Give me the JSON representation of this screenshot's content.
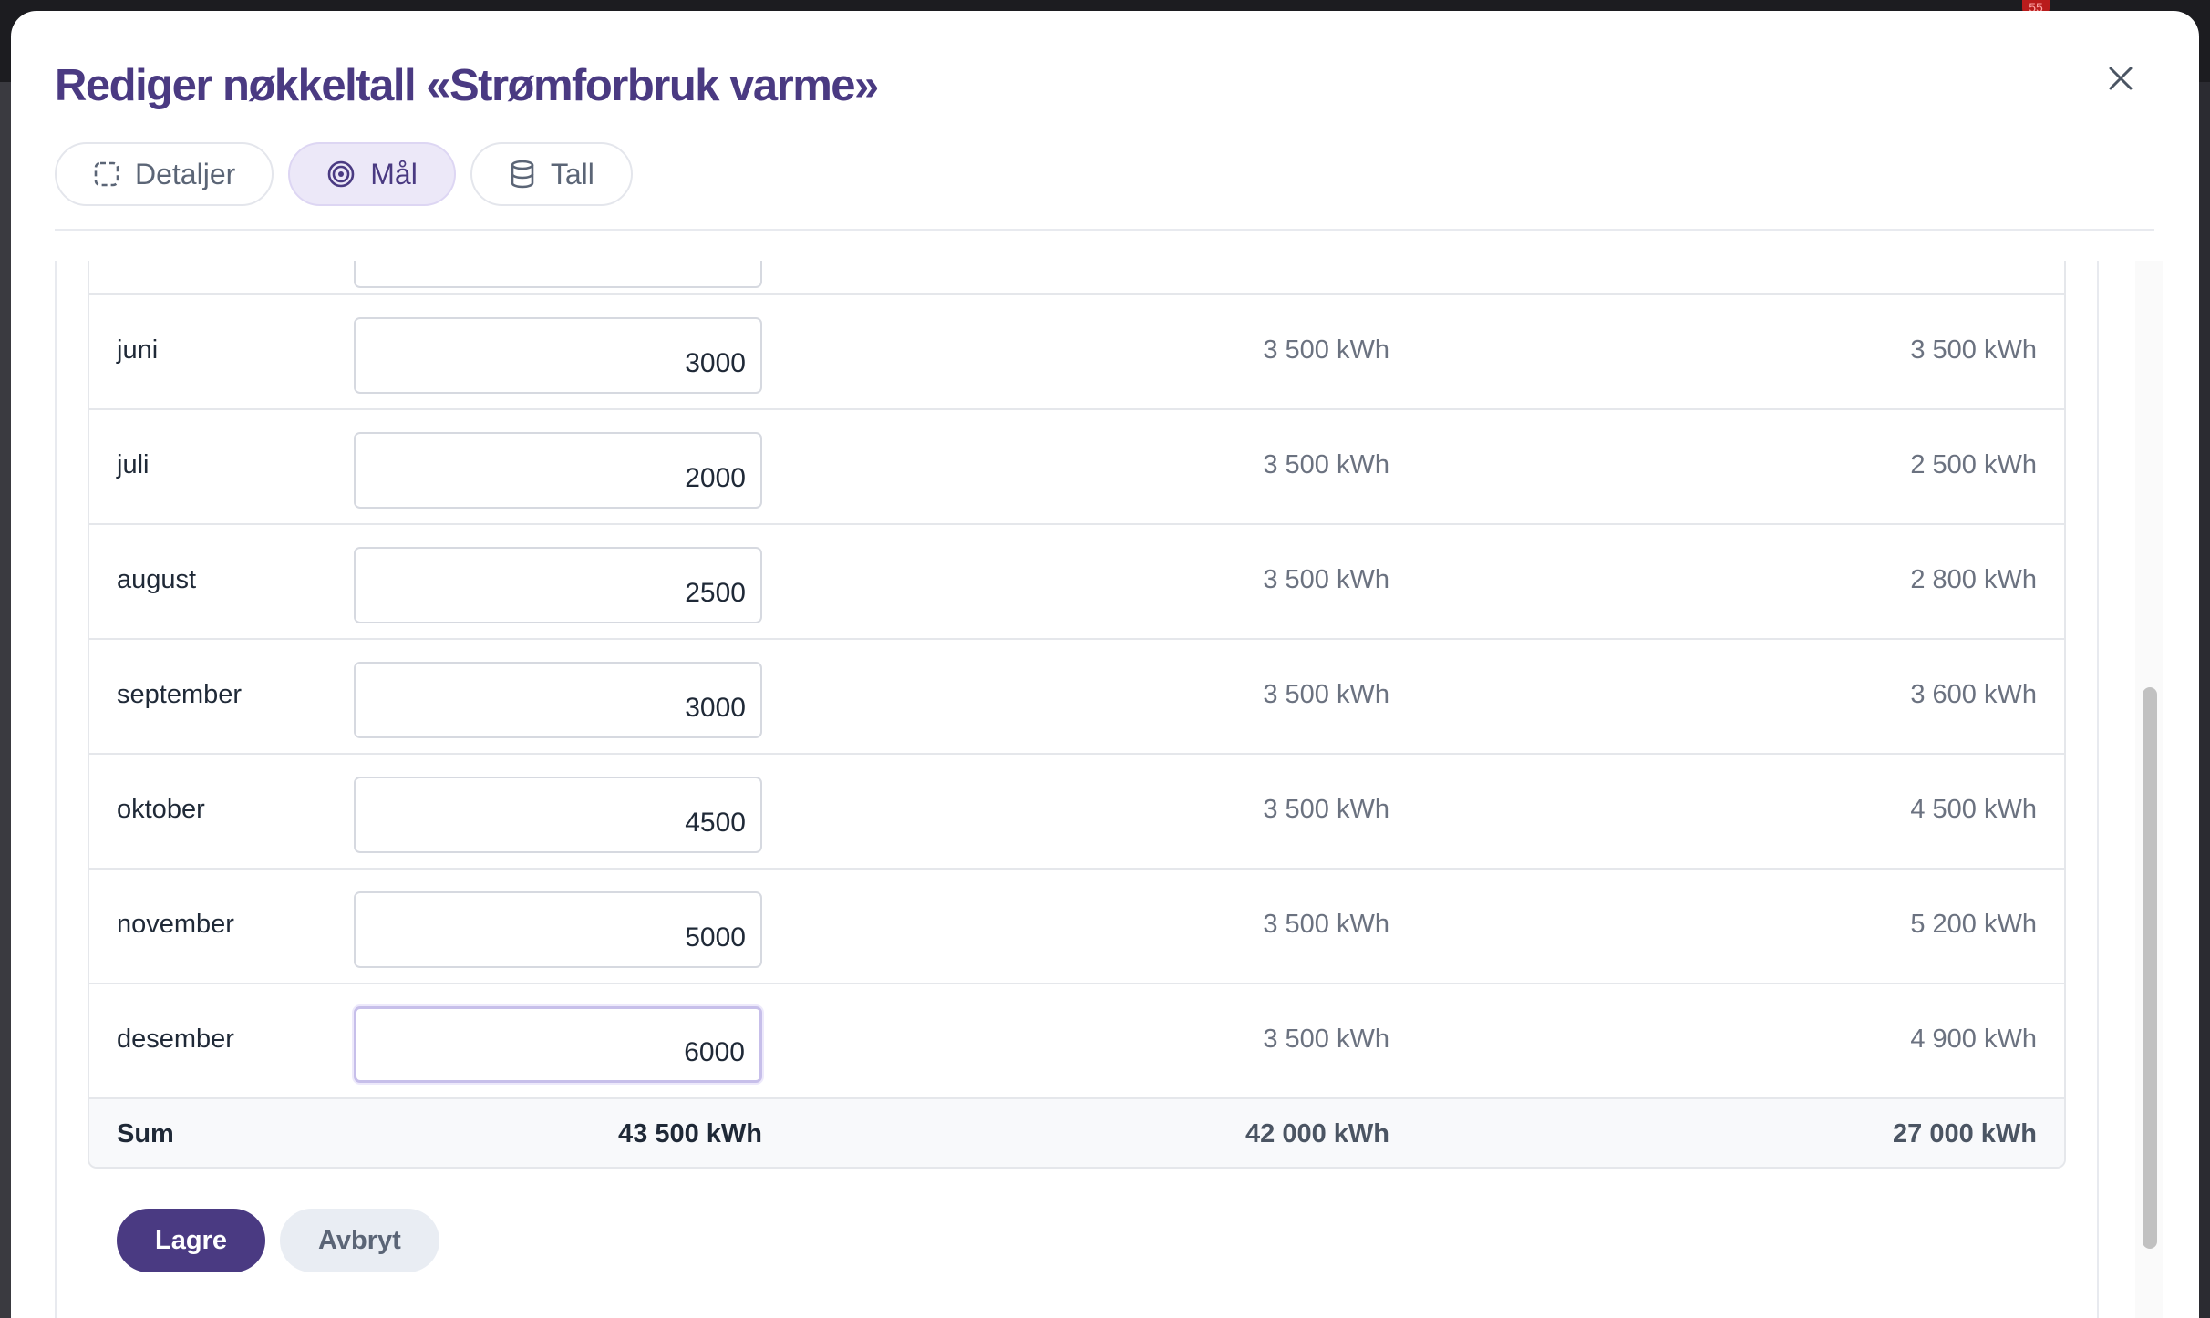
{
  "modal": {
    "title": "Rediger nøkkeltall «Strømforbruk varme»"
  },
  "tabs": [
    {
      "label": "Detaljer",
      "icon": "dashed-square-icon",
      "active": false
    },
    {
      "label": "Mål",
      "icon": "target-icon",
      "active": true
    },
    {
      "label": "Tall",
      "icon": "database-icon",
      "active": false
    }
  ],
  "table": {
    "rows": [
      {
        "month": "juni",
        "goal": "3000",
        "previous": "3 500 kWh",
        "actual": "3 500 kWh"
      },
      {
        "month": "juli",
        "goal": "2000",
        "previous": "3 500 kWh",
        "actual": "2 500 kWh"
      },
      {
        "month": "august",
        "goal": "2500",
        "previous": "3 500 kWh",
        "actual": "2 800 kWh"
      },
      {
        "month": "september",
        "goal": "3000",
        "previous": "3 500 kWh",
        "actual": "3 600 kWh"
      },
      {
        "month": "oktober",
        "goal": "4500",
        "previous": "3 500 kWh",
        "actual": "4 500 kWh"
      },
      {
        "month": "november",
        "goal": "5000",
        "previous": "3 500 kWh",
        "actual": "5 200 kWh"
      },
      {
        "month": "desember",
        "goal": "6000",
        "previous": "3 500 kWh",
        "actual": "4 900 kWh"
      }
    ],
    "sum": {
      "label": "Sum",
      "goal": "43 500 kWh",
      "previous": "42 000 kWh",
      "actual": "27 000 kWh"
    }
  },
  "actions": {
    "save_label": "Lagre",
    "cancel_label": "Avbryt"
  },
  "background": {
    "notification_count": "55"
  },
  "colors": {
    "brand": "#4a3a82",
    "active_tab_bg": "#ece8f8",
    "secondary_button_bg": "#e9edf3"
  }
}
